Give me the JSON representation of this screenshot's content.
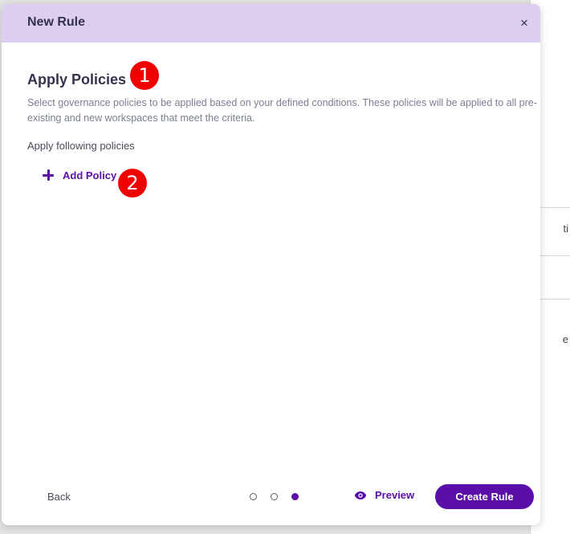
{
  "dialog": {
    "title": "New Rule",
    "close_glyph": "×"
  },
  "section": {
    "title": "Apply Policies",
    "description": "Select governance policies to be applied based on your defined conditions. These policies will be applied to all pre-existing and new workspaces that meet the criteria.",
    "policies_label": "Apply following policies",
    "add_policy_label": "Add Policy",
    "add_policy_icon": "plus-icon"
  },
  "markers": [
    "1",
    "2"
  ],
  "footer": {
    "back_label": "Back",
    "steps": {
      "total": 3,
      "current": 3
    },
    "preview_label": "Preview",
    "preview_icon": "eye-icon",
    "create_label": "Create Rule"
  },
  "background": {
    "fragment_1": "ti",
    "fragment_2": "e"
  },
  "colors": {
    "header_bg": "#ddcdf0",
    "accent": "#5b0fa8",
    "marker": "#f00000"
  }
}
